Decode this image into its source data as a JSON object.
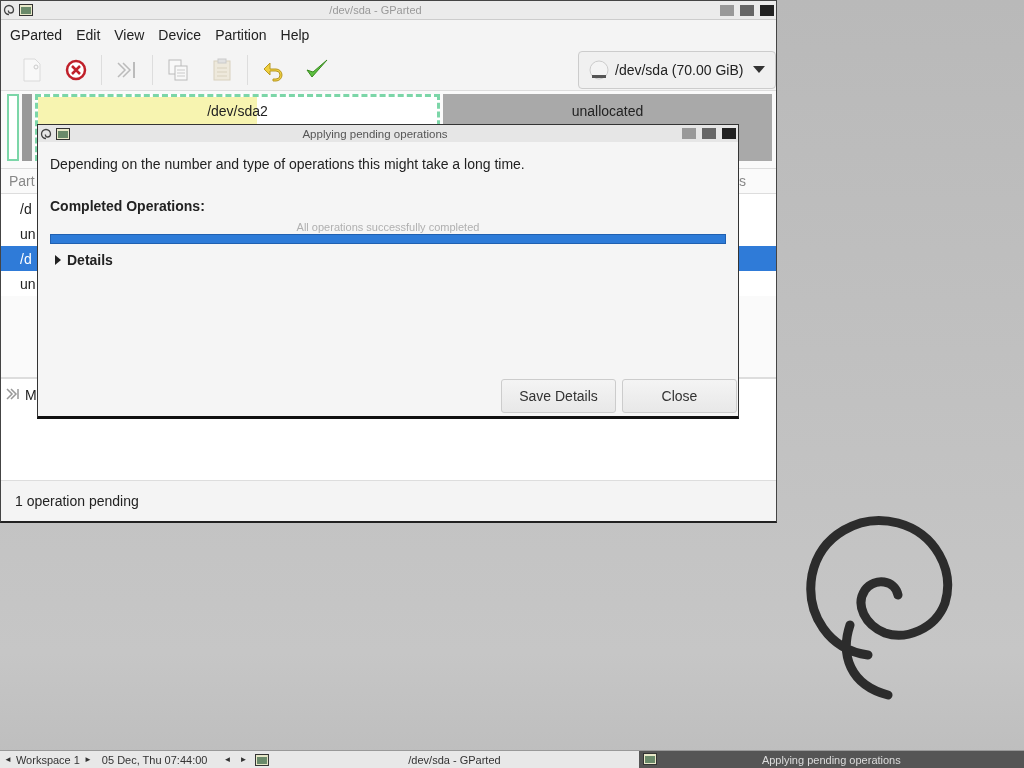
{
  "main_window": {
    "title": "/dev/sda - GParted",
    "menu": [
      "GParted",
      "Edit",
      "View",
      "Device",
      "Partition",
      "Help"
    ],
    "toolbar": [
      {
        "kind": "new",
        "disabled": true
      },
      {
        "kind": "delete",
        "disabled": false
      },
      {
        "kind": "resize",
        "disabled": true
      },
      {
        "kind": "copy",
        "disabled": true
      },
      {
        "kind": "paste",
        "disabled": true
      },
      {
        "kind": "undo",
        "disabled": false
      },
      {
        "kind": "apply",
        "disabled": false
      }
    ],
    "device": "/dev/sda (70.00 GiB)",
    "disk_map": [
      {
        "kind": "partition",
        "label": "/dev/sda2",
        "level": 0.55,
        "selected": true
      },
      {
        "kind": "unallocated",
        "label": "unallocated",
        "selected": false
      }
    ],
    "table": {
      "columns": [
        "Part",
        "s"
      ],
      "rows": [
        {
          "partition": "/d",
          "selected": false
        },
        {
          "partition": "un",
          "selected": false
        },
        {
          "partition": "/d",
          "selected": true
        },
        {
          "partition": "un",
          "selected": false
        }
      ]
    },
    "operations": [
      "M"
    ],
    "status": "1 operation pending"
  },
  "dialog": {
    "title": "Applying pending operations",
    "message": "Depending on the number and type of operations this might take a long time.",
    "completed_label": "Completed Operations:",
    "progress": {
      "text": "All operations successfully completed",
      "level": 1
    },
    "details": {
      "label": "Details",
      "expanded": false
    },
    "buttons": [
      "Save Details",
      "Close"
    ]
  },
  "taskbar": {
    "workspace_prev": "◄",
    "workspace": "Workspace 1",
    "workspace_next": "►",
    "clock": "05 Dec, Thu 07:44:00",
    "nav_prev": "◄",
    "nav_next": "►",
    "tasks": [
      {
        "title": "/dev/sda - GParted",
        "selected": false
      },
      {
        "title": "Applying pending operations",
        "selected": true
      }
    ]
  }
}
